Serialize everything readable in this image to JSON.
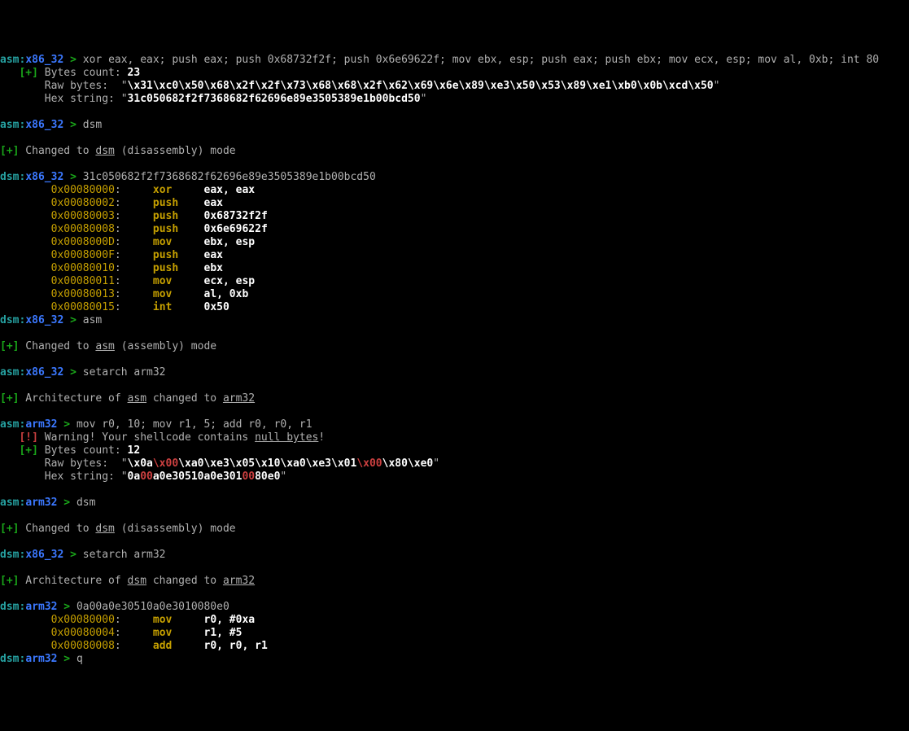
{
  "lines": [
    {
      "prompt_mode": "asm",
      "prompt_arch": "x86_32",
      "cmd": "xor eax, eax; push eax; push 0x68732f2f; push 0x6e69622f; mov ebx, esp; push eax; push ebx; mov ecx, esp; mov al, 0xb; int 80"
    },
    {
      "info_indent": 3,
      "info_tag": "[+]",
      "info_text": " Bytes count: ",
      "info_bold": "23"
    },
    {
      "raw_label": "       Raw bytes:  \"",
      "raw_body_white": "\\x31\\xc0\\x50\\x68\\x2f\\x2f\\x73\\x68\\x68\\x2f\\x62\\x69\\x6e\\x89\\xe3\\x50\\x53\\x89\\xe1\\xb0\\x0b\\xcd\\x50",
      "raw_trail": "\""
    },
    {
      "hex_label": "       Hex string: \"",
      "hex_body_white": "31c050682f2f7368682f62696e89e3505389e1b00bcd50",
      "hex_trail": "\""
    },
    {
      "blank": true
    },
    {
      "prompt_mode": "asm",
      "prompt_arch": "x86_32",
      "cmd": "dsm"
    },
    {
      "blank": true
    },
    {
      "info_indent": 0,
      "info_tag": "[+]",
      "info_text": " Changed to ",
      "under_word": "dsm",
      "info_text2": " (disassembly) mode"
    },
    {
      "blank": true
    },
    {
      "prompt_mode": "dsm",
      "prompt_arch": "x86_32",
      "cmd": "31c050682f2f7368682f62696e89e3505389e1b00bcd50"
    },
    {
      "dis_addr": "0x00080000",
      "dis_mnem": "xor",
      "dis_ops": "eax, eax"
    },
    {
      "dis_addr": "0x00080002",
      "dis_mnem": "push",
      "dis_ops": "eax"
    },
    {
      "dis_addr": "0x00080003",
      "dis_mnem": "push",
      "dis_ops": "0x68732f2f"
    },
    {
      "dis_addr": "0x00080008",
      "dis_mnem": "push",
      "dis_ops": "0x6e69622f"
    },
    {
      "dis_addr": "0x0008000D",
      "dis_mnem": "mov",
      "dis_ops": "ebx, esp"
    },
    {
      "dis_addr": "0x0008000F",
      "dis_mnem": "push",
      "dis_ops": "eax"
    },
    {
      "dis_addr": "0x00080010",
      "dis_mnem": "push",
      "dis_ops": "ebx"
    },
    {
      "dis_addr": "0x00080011",
      "dis_mnem": "mov",
      "dis_ops": "ecx, esp"
    },
    {
      "dis_addr": "0x00080013",
      "dis_mnem": "mov",
      "dis_ops": "al, 0xb"
    },
    {
      "dis_addr": "0x00080015",
      "dis_mnem": "int",
      "dis_ops": "0x50"
    },
    {
      "prompt_mode": "dsm",
      "prompt_arch": "x86_32",
      "cmd": "asm"
    },
    {
      "blank": true
    },
    {
      "info_indent": 0,
      "info_tag": "[+]",
      "info_text": " Changed to ",
      "under_word": "asm",
      "info_text2": " (assembly) mode"
    },
    {
      "blank": true
    },
    {
      "prompt_mode": "asm",
      "prompt_arch": "x86_32",
      "cmd": "setarch arm32"
    },
    {
      "blank": true
    },
    {
      "info_indent": 0,
      "info_tag": "[+]",
      "info_text": " Architecture of ",
      "under_word": "asm",
      "info_text2": " changed to ",
      "under_word2": "arm32"
    },
    {
      "blank": true
    },
    {
      "prompt_mode": "asm",
      "prompt_arch": "arm32",
      "cmd": "mov r0, 10; mov r1, 5; add r0, r0, r1"
    },
    {
      "info_indent": 3,
      "info_tag": "[!]",
      "info_text": " Warning! Your shellcode contains ",
      "under_word": "null bytes",
      "info_text2": "!"
    },
    {
      "info_indent": 3,
      "info_tag": "[+]",
      "info_text": " Bytes count: ",
      "info_bold": "12"
    },
    {
      "raw_mixed": [
        {
          "t": "       Raw bytes:  \"",
          "c": "grey"
        },
        {
          "t": "\\x0a",
          "c": "white bold"
        },
        {
          "t": "\\x00",
          "c": "red bold"
        },
        {
          "t": "\\xa0\\xe3\\x05\\x10\\xa0\\xe3\\x01",
          "c": "white bold"
        },
        {
          "t": "\\x00",
          "c": "red bold"
        },
        {
          "t": "\\x80\\xe0",
          "c": "white bold"
        },
        {
          "t": "\"",
          "c": "grey"
        }
      ]
    },
    {
      "raw_mixed": [
        {
          "t": "       Hex string: \"",
          "c": "grey"
        },
        {
          "t": "0a",
          "c": "white bold"
        },
        {
          "t": "00",
          "c": "red bold"
        },
        {
          "t": "a0e30510a0e301",
          "c": "white bold"
        },
        {
          "t": "00",
          "c": "red bold"
        },
        {
          "t": "80e0",
          "c": "white bold"
        },
        {
          "t": "\"",
          "c": "grey"
        }
      ]
    },
    {
      "blank": true
    },
    {
      "prompt_mode": "asm",
      "prompt_arch": "arm32",
      "cmd": "dsm"
    },
    {
      "blank": true
    },
    {
      "info_indent": 0,
      "info_tag": "[+]",
      "info_text": " Changed to ",
      "under_word": "dsm",
      "info_text2": " (disassembly) mode"
    },
    {
      "blank": true
    },
    {
      "prompt_mode": "dsm",
      "prompt_arch": "x86_32",
      "cmd": "setarch arm32"
    },
    {
      "blank": true
    },
    {
      "info_indent": 0,
      "info_tag": "[+]",
      "info_text": " Architecture of ",
      "under_word": "dsm",
      "info_text2": " changed to ",
      "under_word2": "arm32"
    },
    {
      "blank": true
    },
    {
      "prompt_mode": "dsm",
      "prompt_arch": "arm32",
      "cmd": "0a00a0e30510a0e3010080e0"
    },
    {
      "dis_addr": "0x00080000",
      "dis_mnem": "mov",
      "dis_ops": "r0, #0xa"
    },
    {
      "dis_addr": "0x00080004",
      "dis_mnem": "mov",
      "dis_ops": "r1, #5"
    },
    {
      "dis_addr": "0x00080008",
      "dis_mnem": "add",
      "dis_ops": "r0, r0, r1"
    },
    {
      "prompt_mode": "dsm",
      "prompt_arch": "arm32",
      "cmd": "q"
    }
  ]
}
